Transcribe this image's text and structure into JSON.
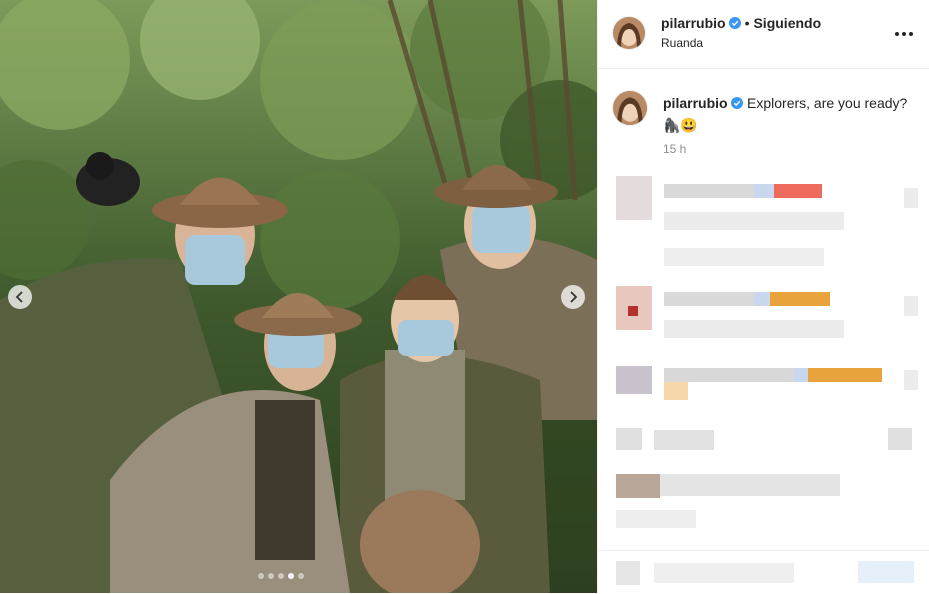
{
  "post": {
    "username": "pilarrubio",
    "separator": "•",
    "follow_status": "Siguiendo",
    "location": "Ruanda",
    "more_icon": "more-horizontal-icon"
  },
  "caption": {
    "username": "pilarrubio",
    "text": "Explorers, are you ready?",
    "emojis": "🦍😃",
    "time": "15 h"
  },
  "carousel": {
    "slide_count": 5,
    "active_index": 3,
    "prev_icon": "chevron-left-icon",
    "next_icon": "chevron-right-icon"
  },
  "colors": {
    "verified": "#3897f0",
    "text": "#262626",
    "muted": "#8e8e8e",
    "blur_orange": "#e8a33c",
    "blur_red": "#ee6a5c"
  }
}
